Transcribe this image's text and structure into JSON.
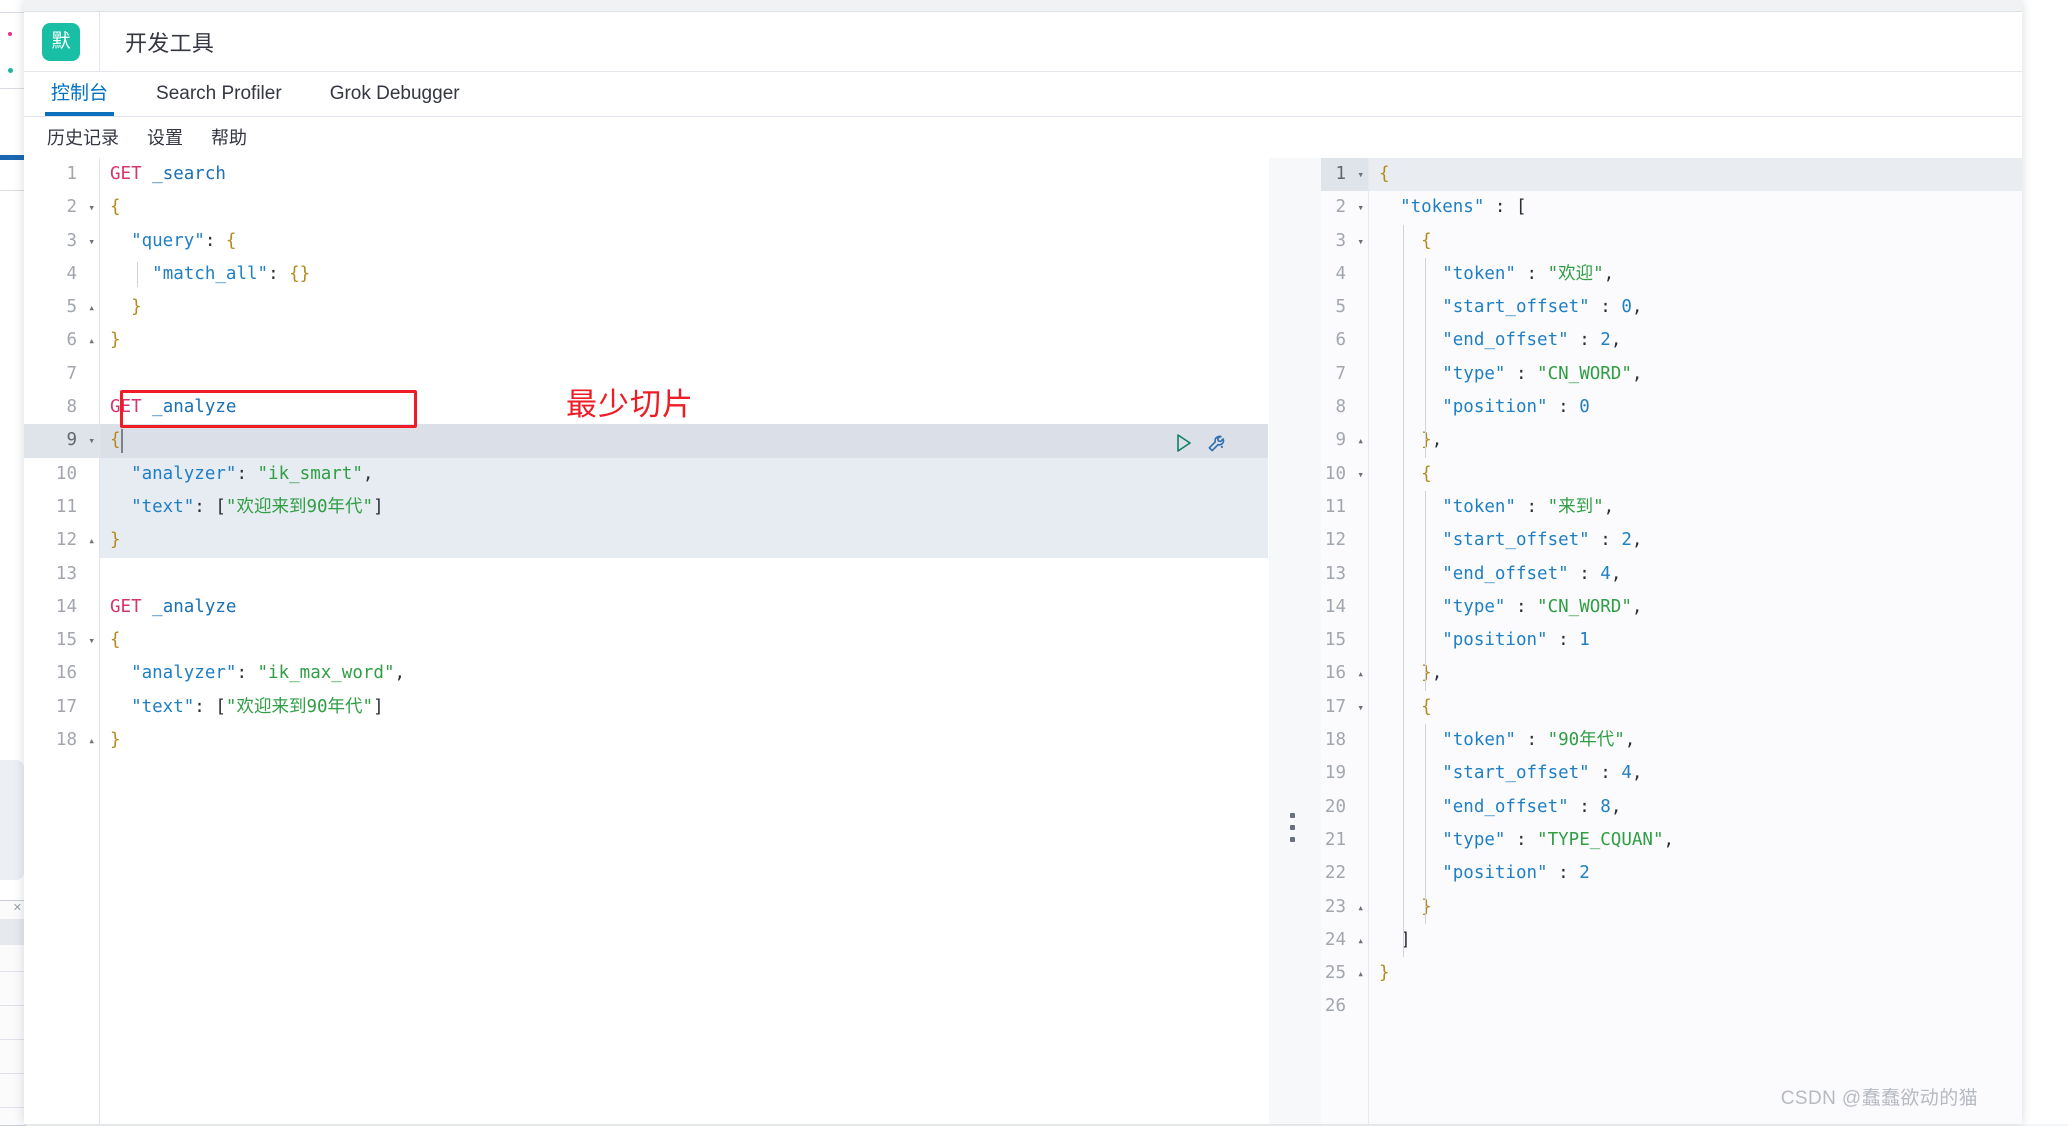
{
  "window": {
    "space_badge": "默",
    "app_title": "开发工具"
  },
  "tabs": [
    {
      "label": "控制台",
      "active": true
    },
    {
      "label": "Search Profiler",
      "active": false
    },
    {
      "label": "Grok Debugger",
      "active": false
    }
  ],
  "console_menu": [
    {
      "label": "历史记录"
    },
    {
      "label": "设置"
    },
    {
      "label": "帮助"
    }
  ],
  "editor": {
    "cursor_line": 9,
    "selection_lines": [
      9,
      12
    ],
    "total_lines": 18,
    "lines": [
      {
        "n": 1,
        "fold": "",
        "tokens": [
          {
            "t": "method",
            "v": "GET"
          },
          {
            "t": "plain",
            "v": " "
          },
          {
            "t": "url",
            "v": "_search"
          }
        ]
      },
      {
        "n": 2,
        "fold": "▾",
        "tokens": [
          {
            "t": "brace",
            "v": "{"
          }
        ]
      },
      {
        "n": 3,
        "fold": "▾",
        "tokens": [
          {
            "t": "plain",
            "v": "  "
          },
          {
            "t": "key",
            "v": "\"query\""
          },
          {
            "t": "punc",
            "v": ": "
          },
          {
            "t": "brace",
            "v": "{"
          }
        ]
      },
      {
        "n": 4,
        "fold": "",
        "tokens": [
          {
            "t": "plain",
            "v": "    "
          },
          {
            "t": "key",
            "v": "\"match_all\""
          },
          {
            "t": "punc",
            "v": ": "
          },
          {
            "t": "brace",
            "v": "{}"
          }
        ]
      },
      {
        "n": 5,
        "fold": "▴",
        "tokens": [
          {
            "t": "plain",
            "v": "  "
          },
          {
            "t": "brace",
            "v": "}"
          }
        ]
      },
      {
        "n": 6,
        "fold": "▴",
        "tokens": [
          {
            "t": "brace",
            "v": "}"
          }
        ]
      },
      {
        "n": 7,
        "fold": "",
        "tokens": []
      },
      {
        "n": 8,
        "fold": "",
        "tokens": [
          {
            "t": "method",
            "v": "GET"
          },
          {
            "t": "plain",
            "v": " "
          },
          {
            "t": "url",
            "v": "_analyze"
          }
        ]
      },
      {
        "n": 9,
        "fold": "▾",
        "tokens": [
          {
            "t": "brace",
            "v": "{"
          }
        ]
      },
      {
        "n": 10,
        "fold": "",
        "tokens": [
          {
            "t": "plain",
            "v": "  "
          },
          {
            "t": "key",
            "v": "\"analyzer\""
          },
          {
            "t": "punc",
            "v": ": "
          },
          {
            "t": "str",
            "v": "\"ik_smart\""
          },
          {
            "t": "punc",
            "v": ","
          }
        ]
      },
      {
        "n": 11,
        "fold": "",
        "tokens": [
          {
            "t": "plain",
            "v": "  "
          },
          {
            "t": "key",
            "v": "\"text\""
          },
          {
            "t": "punc",
            "v": ": ["
          },
          {
            "t": "str",
            "v": "\"欢迎来到90年代\""
          },
          {
            "t": "punc",
            "v": "]"
          }
        ]
      },
      {
        "n": 12,
        "fold": "▴",
        "tokens": [
          {
            "t": "brace",
            "v": "}"
          }
        ]
      },
      {
        "n": 13,
        "fold": "",
        "tokens": []
      },
      {
        "n": 14,
        "fold": "",
        "tokens": [
          {
            "t": "method",
            "v": "GET"
          },
          {
            "t": "plain",
            "v": " "
          },
          {
            "t": "url",
            "v": "_analyze"
          }
        ]
      },
      {
        "n": 15,
        "fold": "▾",
        "tokens": [
          {
            "t": "brace",
            "v": "{"
          }
        ]
      },
      {
        "n": 16,
        "fold": "",
        "tokens": [
          {
            "t": "plain",
            "v": "  "
          },
          {
            "t": "key",
            "v": "\"analyzer\""
          },
          {
            "t": "punc",
            "v": ": "
          },
          {
            "t": "str",
            "v": "\"ik_max_word\""
          },
          {
            "t": "punc",
            "v": ","
          }
        ]
      },
      {
        "n": 17,
        "fold": "",
        "tokens": [
          {
            "t": "plain",
            "v": "  "
          },
          {
            "t": "key",
            "v": "\"text\""
          },
          {
            "t": "punc",
            "v": ": ["
          },
          {
            "t": "str",
            "v": "\"欢迎来到90年代\""
          },
          {
            "t": "punc",
            "v": "]"
          }
        ]
      },
      {
        "n": 18,
        "fold": "▴",
        "tokens": [
          {
            "t": "brace",
            "v": "}"
          }
        ]
      }
    ],
    "actions": {
      "run_label": "send-request",
      "wrench_label": "request-options"
    }
  },
  "response": {
    "cursor_line": 1,
    "total_lines": 26,
    "lines": [
      {
        "n": 1,
        "fold": "▾",
        "tokens": [
          {
            "t": "brace",
            "v": "{"
          }
        ]
      },
      {
        "n": 2,
        "fold": "▾",
        "tokens": [
          {
            "t": "plain",
            "v": "  "
          },
          {
            "t": "key",
            "v": "\"tokens\""
          },
          {
            "t": "punc",
            "v": " : ["
          }
        ]
      },
      {
        "n": 3,
        "fold": "▾",
        "tokens": [
          {
            "t": "plain",
            "v": "    "
          },
          {
            "t": "brace",
            "v": "{"
          }
        ]
      },
      {
        "n": 4,
        "fold": "",
        "tokens": [
          {
            "t": "plain",
            "v": "      "
          },
          {
            "t": "key",
            "v": "\"token\""
          },
          {
            "t": "punc",
            "v": " : "
          },
          {
            "t": "str",
            "v": "\"欢迎\""
          },
          {
            "t": "punc",
            "v": ","
          }
        ]
      },
      {
        "n": 5,
        "fold": "",
        "tokens": [
          {
            "t": "plain",
            "v": "      "
          },
          {
            "t": "key",
            "v": "\"start_offset\""
          },
          {
            "t": "punc",
            "v": " : "
          },
          {
            "t": "num",
            "v": "0"
          },
          {
            "t": "punc",
            "v": ","
          }
        ]
      },
      {
        "n": 6,
        "fold": "",
        "tokens": [
          {
            "t": "plain",
            "v": "      "
          },
          {
            "t": "key",
            "v": "\"end_offset\""
          },
          {
            "t": "punc",
            "v": " : "
          },
          {
            "t": "num",
            "v": "2"
          },
          {
            "t": "punc",
            "v": ","
          }
        ]
      },
      {
        "n": 7,
        "fold": "",
        "tokens": [
          {
            "t": "plain",
            "v": "      "
          },
          {
            "t": "key",
            "v": "\"type\""
          },
          {
            "t": "punc",
            "v": " : "
          },
          {
            "t": "str",
            "v": "\"CN_WORD\""
          },
          {
            "t": "punc",
            "v": ","
          }
        ]
      },
      {
        "n": 8,
        "fold": "",
        "tokens": [
          {
            "t": "plain",
            "v": "      "
          },
          {
            "t": "key",
            "v": "\"position\""
          },
          {
            "t": "punc",
            "v": " : "
          },
          {
            "t": "num",
            "v": "0"
          }
        ]
      },
      {
        "n": 9,
        "fold": "▴",
        "tokens": [
          {
            "t": "plain",
            "v": "    "
          },
          {
            "t": "brace",
            "v": "}"
          },
          {
            "t": "punc",
            "v": ","
          }
        ]
      },
      {
        "n": 10,
        "fold": "▾",
        "tokens": [
          {
            "t": "plain",
            "v": "    "
          },
          {
            "t": "brace",
            "v": "{"
          }
        ]
      },
      {
        "n": 11,
        "fold": "",
        "tokens": [
          {
            "t": "plain",
            "v": "      "
          },
          {
            "t": "key",
            "v": "\"token\""
          },
          {
            "t": "punc",
            "v": " : "
          },
          {
            "t": "str",
            "v": "\"来到\""
          },
          {
            "t": "punc",
            "v": ","
          }
        ]
      },
      {
        "n": 12,
        "fold": "",
        "tokens": [
          {
            "t": "plain",
            "v": "      "
          },
          {
            "t": "key",
            "v": "\"start_offset\""
          },
          {
            "t": "punc",
            "v": " : "
          },
          {
            "t": "num",
            "v": "2"
          },
          {
            "t": "punc",
            "v": ","
          }
        ]
      },
      {
        "n": 13,
        "fold": "",
        "tokens": [
          {
            "t": "plain",
            "v": "      "
          },
          {
            "t": "key",
            "v": "\"end_offset\""
          },
          {
            "t": "punc",
            "v": " : "
          },
          {
            "t": "num",
            "v": "4"
          },
          {
            "t": "punc",
            "v": ","
          }
        ]
      },
      {
        "n": 14,
        "fold": "",
        "tokens": [
          {
            "t": "plain",
            "v": "      "
          },
          {
            "t": "key",
            "v": "\"type\""
          },
          {
            "t": "punc",
            "v": " : "
          },
          {
            "t": "str",
            "v": "\"CN_WORD\""
          },
          {
            "t": "punc",
            "v": ","
          }
        ]
      },
      {
        "n": 15,
        "fold": "",
        "tokens": [
          {
            "t": "plain",
            "v": "      "
          },
          {
            "t": "key",
            "v": "\"position\""
          },
          {
            "t": "punc",
            "v": " : "
          },
          {
            "t": "num",
            "v": "1"
          }
        ]
      },
      {
        "n": 16,
        "fold": "▴",
        "tokens": [
          {
            "t": "plain",
            "v": "    "
          },
          {
            "t": "brace",
            "v": "}"
          },
          {
            "t": "punc",
            "v": ","
          }
        ]
      },
      {
        "n": 17,
        "fold": "▾",
        "tokens": [
          {
            "t": "plain",
            "v": "    "
          },
          {
            "t": "brace",
            "v": "{"
          }
        ]
      },
      {
        "n": 18,
        "fold": "",
        "tokens": [
          {
            "t": "plain",
            "v": "      "
          },
          {
            "t": "key",
            "v": "\"token\""
          },
          {
            "t": "punc",
            "v": " : "
          },
          {
            "t": "str",
            "v": "\"90年代\""
          },
          {
            "t": "punc",
            "v": ","
          }
        ]
      },
      {
        "n": 19,
        "fold": "",
        "tokens": [
          {
            "t": "plain",
            "v": "      "
          },
          {
            "t": "key",
            "v": "\"start_offset\""
          },
          {
            "t": "punc",
            "v": " : "
          },
          {
            "t": "num",
            "v": "4"
          },
          {
            "t": "punc",
            "v": ","
          }
        ]
      },
      {
        "n": 20,
        "fold": "",
        "tokens": [
          {
            "t": "plain",
            "v": "      "
          },
          {
            "t": "key",
            "v": "\"end_offset\""
          },
          {
            "t": "punc",
            "v": " : "
          },
          {
            "t": "num",
            "v": "8"
          },
          {
            "t": "punc",
            "v": ","
          }
        ]
      },
      {
        "n": 21,
        "fold": "",
        "tokens": [
          {
            "t": "plain",
            "v": "      "
          },
          {
            "t": "key",
            "v": "\"type\""
          },
          {
            "t": "punc",
            "v": " : "
          },
          {
            "t": "str",
            "v": "\"TYPE_CQUAN\""
          },
          {
            "t": "punc",
            "v": ","
          }
        ]
      },
      {
        "n": 22,
        "fold": "",
        "tokens": [
          {
            "t": "plain",
            "v": "      "
          },
          {
            "t": "key",
            "v": "\"position\""
          },
          {
            "t": "punc",
            "v": " : "
          },
          {
            "t": "num",
            "v": "2"
          }
        ]
      },
      {
        "n": 23,
        "fold": "▴",
        "tokens": [
          {
            "t": "plain",
            "v": "    "
          },
          {
            "t": "brace",
            "v": "}"
          }
        ]
      },
      {
        "n": 24,
        "fold": "▴",
        "tokens": [
          {
            "t": "plain",
            "v": "  "
          },
          {
            "t": "punc",
            "v": "]"
          }
        ]
      },
      {
        "n": 25,
        "fold": "▴",
        "tokens": [
          {
            "t": "brace",
            "v": "}"
          }
        ]
      },
      {
        "n": 26,
        "fold": "",
        "tokens": []
      }
    ]
  },
  "annotation": {
    "text": "最少切片",
    "color": "#ee1c25"
  },
  "watermark": {
    "text": "CSDN @蠢蠢欲动的猫"
  },
  "colors": {
    "accent": "#0a6fbd",
    "space_badge_bg": "#18bfa5",
    "annotation_red": "#ee1c25",
    "string_green": "#2f9e44",
    "key_blue": "#1f7fc4",
    "method_pink": "#d6336c"
  }
}
